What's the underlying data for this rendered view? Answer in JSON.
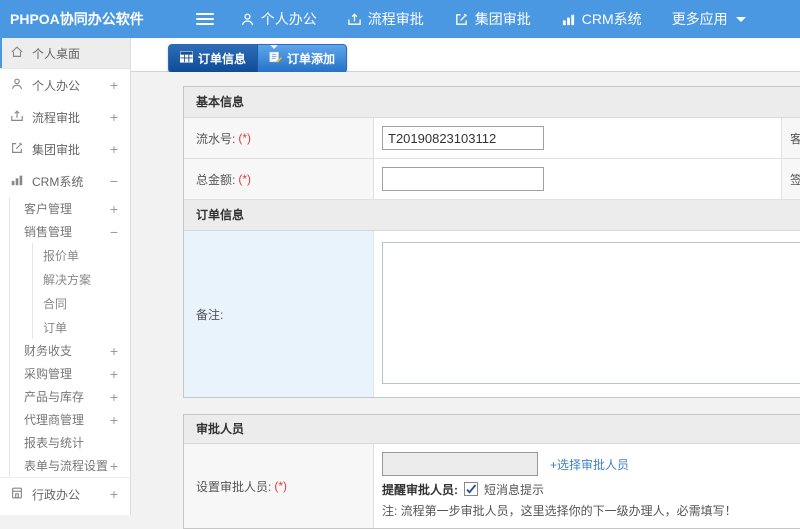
{
  "topbar": {
    "brand": "PHPOA协同办公软件",
    "nav": [
      {
        "label": "个人办公",
        "icon": "user-icon"
      },
      {
        "label": "流程审批",
        "icon": "process-icon"
      },
      {
        "label": "集团审批",
        "icon": "edit-icon"
      },
      {
        "label": "CRM系统",
        "icon": "chart-icon"
      },
      {
        "label": "更多应用",
        "icon": "caret-down-icon"
      }
    ]
  },
  "tabs": [
    {
      "label": "订单信息",
      "icon": "table-icon",
      "active": true
    },
    {
      "label": "订单添加",
      "icon": "add-doc-icon",
      "active": false
    }
  ],
  "sidebar": {
    "items": [
      {
        "label": "个人桌面",
        "icon": "home-icon",
        "expander": "",
        "level": 1,
        "active": true
      },
      {
        "label": "个人办公",
        "icon": "user-icon",
        "expander": "+",
        "level": 1
      },
      {
        "label": "流程审批",
        "icon": "process-icon",
        "expander": "+",
        "level": 1
      },
      {
        "label": "集团审批",
        "icon": "edit-icon",
        "expander": "+",
        "level": 1
      },
      {
        "label": "CRM系统",
        "icon": "chart-icon",
        "expander": "−",
        "level": 1
      },
      {
        "label": "客户管理",
        "expander": "+",
        "level": 2
      },
      {
        "label": "销售管理",
        "expander": "−",
        "level": 2
      },
      {
        "label": "报价单",
        "expander": "",
        "level": 3
      },
      {
        "label": "解决方案",
        "expander": "",
        "level": 3
      },
      {
        "label": "合同",
        "expander": "",
        "level": 3
      },
      {
        "label": "订单",
        "expander": "",
        "level": 3
      },
      {
        "label": "财务收支",
        "expander": "+",
        "level": 2
      },
      {
        "label": "采购管理",
        "expander": "+",
        "level": 2
      },
      {
        "label": "产品与库存",
        "expander": "+",
        "level": 2
      },
      {
        "label": "代理商管理",
        "expander": "+",
        "level": 2
      },
      {
        "label": "报表与统计",
        "expander": "",
        "level": 2
      },
      {
        "label": "表单与流程设置",
        "expander": "+",
        "level": 2
      },
      {
        "label": "行政办公",
        "icon": "building-icon",
        "expander": "+",
        "level": 1
      }
    ]
  },
  "form": {
    "basic": {
      "title": "基本信息",
      "rows": [
        {
          "label": "流水号:",
          "req": "(*)",
          "value": "T20190823103112",
          "label2": "客户名称:"
        },
        {
          "label": "总金额:",
          "req": "(*)",
          "value": "",
          "label2": "签订时间:"
        }
      ]
    },
    "order": {
      "title": "订单信息",
      "remark_label": "备注:",
      "remark_value": ""
    },
    "approver": {
      "title": "审批人员",
      "label": "设置审批人员:",
      "req": "(*)",
      "input_value": "",
      "choose_link": "+选择审批人员",
      "remind_label": "提醒审批人员:",
      "sms_checked": true,
      "sms_label": "短消息提示",
      "note": "注: 流程第一步审批人员，这里选择你的下一级办理人，必需填写！"
    }
  },
  "colors": {
    "topbar_blue": "#4a97e2",
    "tab_active_blue": "#0f4c97",
    "link_blue": "#4183c4",
    "required_red": "#e23b3b",
    "remark_cell_blue": "#e8f3fc"
  }
}
